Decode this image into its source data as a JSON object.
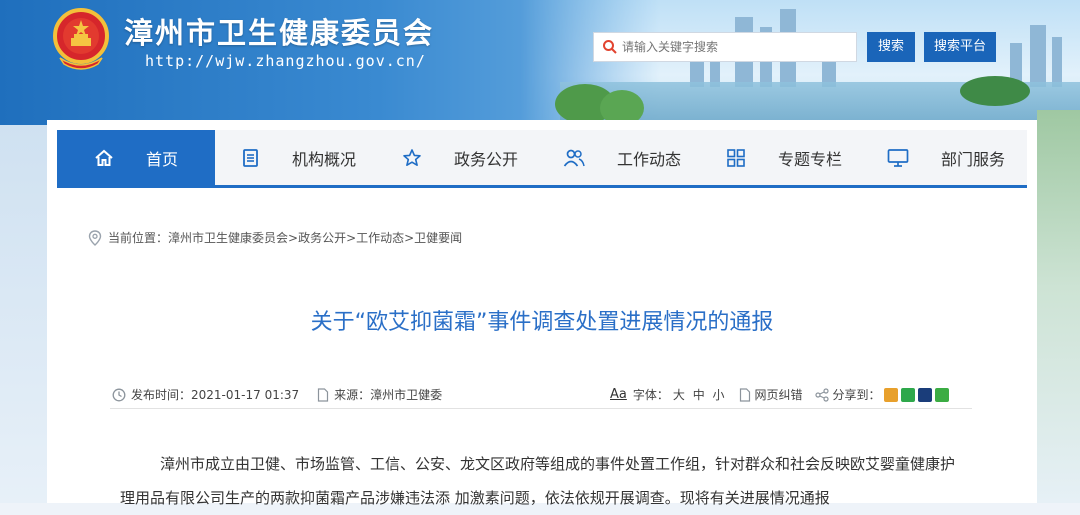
{
  "header": {
    "site_title": "漳州市卫生健康委员会",
    "site_url": "http://wjw.zhangzhou.gov.cn/",
    "search": {
      "placeholder": "请输入关键字搜索",
      "search_button": "搜索",
      "platform_button": "搜索平台"
    }
  },
  "nav": {
    "items": [
      {
        "label": "首页",
        "icon": "home-icon",
        "active": true
      },
      {
        "label": "机构概况",
        "icon": "document-list-icon"
      },
      {
        "label": "政务公开",
        "icon": "star-icon"
      },
      {
        "label": "工作动态",
        "icon": "people-icon"
      },
      {
        "label": "专题专栏",
        "icon": "grid-icon"
      },
      {
        "label": "部门服务",
        "icon": "monitor-icon"
      }
    ]
  },
  "breadcrumb": {
    "prefix": "当前位置：",
    "path": "漳州市卫生健康委员会>政务公开>工作动态>卫健要闻"
  },
  "article": {
    "title": "关于“欧艾抑菌霜”事件调查处置进展情况的通报",
    "publish_label": "发布时间：",
    "publish_time": "2021-01-17 01:37",
    "source_label": "来源：",
    "source": "漳州市卫健委",
    "font_label": "字体：",
    "font_sizes": "大 中 小",
    "aa": "Aa",
    "print_label": "网页纠错",
    "share_label": "分享到：",
    "body": "漳州市成立由卫健、市场监管、工信、公安、龙文区政府等组成的事件处置工作组，针对群众和社会反映欧艾婴童健康护理用品有限公司生产的两款抑菌霜产品涉嫌违法添 加激素问题，依法依规开展调查。现将有关进展情况通报"
  },
  "colors": {
    "brand_blue": "#1f6dc5",
    "title_blue": "#2a6fc7"
  }
}
